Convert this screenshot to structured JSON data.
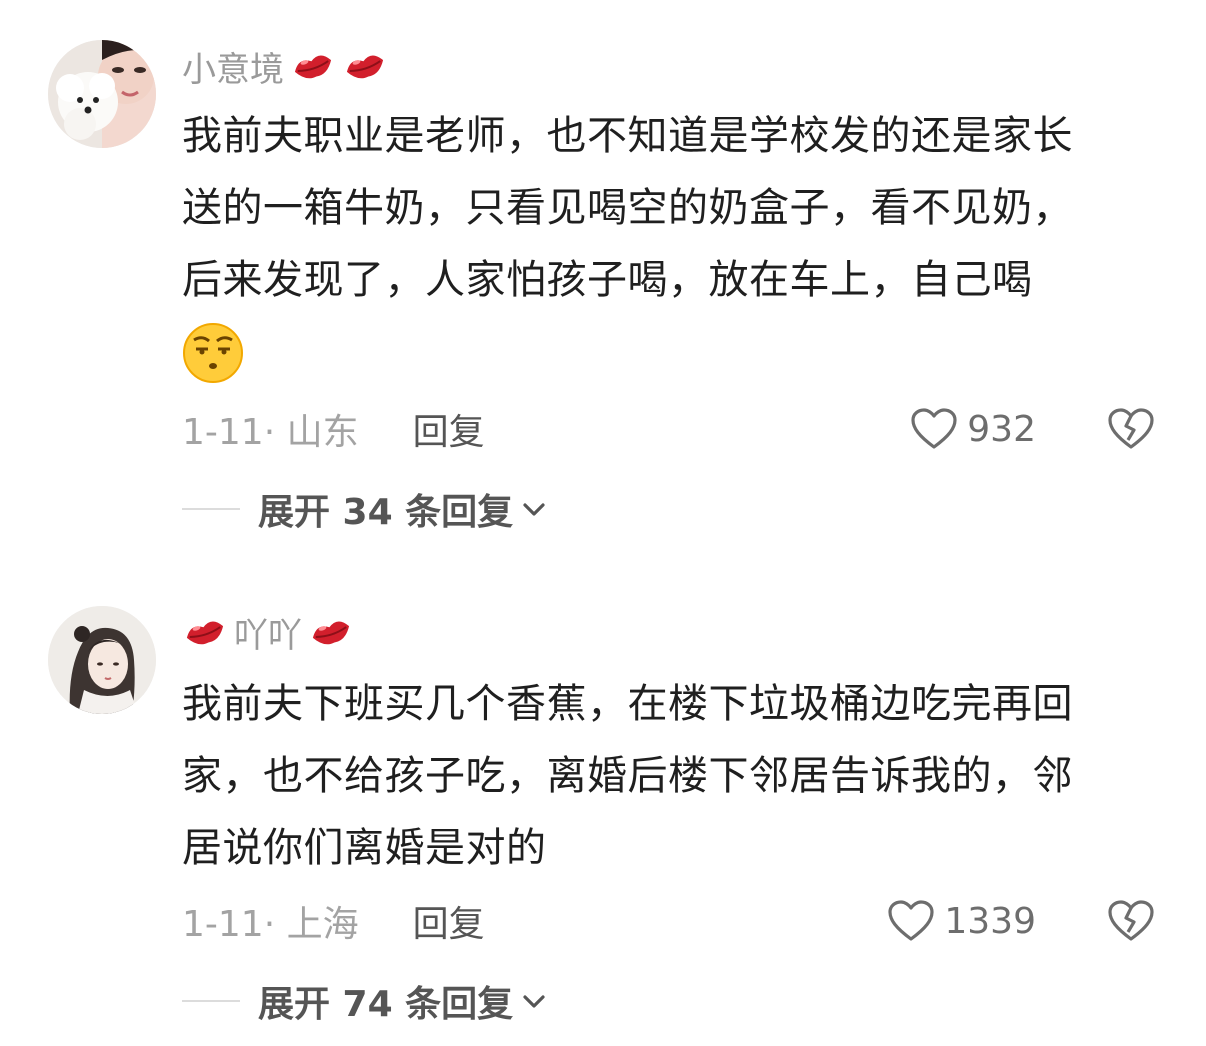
{
  "comments": [
    {
      "username": "小意境",
      "name_emojis": [
        "lips-emoji",
        "lips-emoji"
      ],
      "avatar_icon": "poodle-selfie-avatar",
      "text_lines": [
        "我前夫职业是老师，也不知道是学校发的还是家长",
        "送的一箱牛奶，只看见喝空的奶盒子，看不见奶，",
        "后来发现了，人家怕孩子喝，放在车上，自己喝"
      ],
      "trailing_emoji": "unamused-face-emoji",
      "date_location": "1-11· 山东",
      "reply_label": "回复",
      "likes": "932",
      "expand_label": "展开 34 条回复"
    },
    {
      "username": "吖吖",
      "name_emojis": [
        "lips-emoji",
        "lips-emoji"
      ],
      "avatar_icon": "illustrated-girl-avatar",
      "text_lines": [
        "我前夫下班买几个香蕉，在楼下垃圾桶边吃完再回",
        "家，也不给孩子吃，离婚后楼下邻居告诉我的，邻",
        "居说你们离婚是对的"
      ],
      "date_location": "1-11· 上海",
      "reply_label": "回复",
      "likes": "1339",
      "expand_label": "展开 74 条回复"
    }
  ],
  "colors": {
    "meta_gray": "#a3a3a3",
    "username_gray": "#9a9a9a",
    "lips_red": "#d21f2c",
    "text": "#1f1f1f"
  }
}
